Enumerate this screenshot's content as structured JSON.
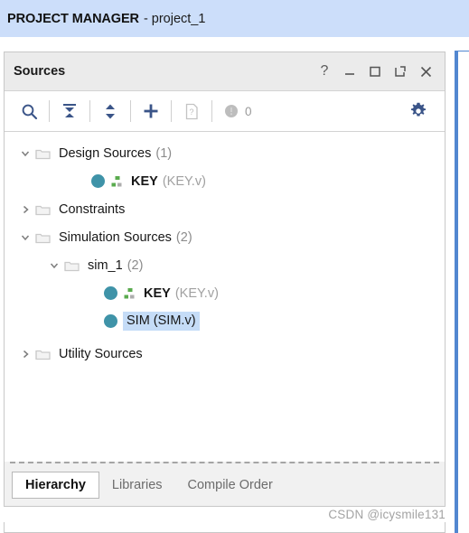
{
  "header": {
    "title": "PROJECT MANAGER",
    "separator": "-",
    "project_name": "project_1"
  },
  "panel": {
    "title": "Sources",
    "titlebar_buttons": [
      {
        "name": "help-icon",
        "label": "?"
      },
      {
        "name": "minimize-icon",
        "label": "_"
      },
      {
        "name": "maximize-icon",
        "label": "□"
      },
      {
        "name": "float-icon",
        "label": "↗"
      },
      {
        "name": "close-icon",
        "label": "×"
      }
    ],
    "toolbar": {
      "search_tooltip": "Search",
      "collapse_tooltip": "Collapse All",
      "expand_tooltip": "Expand All",
      "add_tooltip": "Add Sources",
      "report_tooltip": "Report",
      "warning_count": "0",
      "settings_tooltip": "Settings"
    },
    "colors": {
      "header_bg": "#ccdefa",
      "accent_blue": "#5287d0",
      "toolbar_icon": "#3a5488",
      "module_dot": "#3f93a8",
      "module_green": "#5aab4e",
      "selection": "#c5dcf7"
    }
  },
  "tree": [
    {
      "id": "design-sources",
      "indent": 0,
      "type": "folder",
      "twisty": "expanded",
      "label": "Design Sources",
      "count": "(1)"
    },
    {
      "id": "design-sources-key",
      "indent": 1,
      "type": "module",
      "twisty": "none",
      "label": "KEY",
      "ext": "(KEY.v)",
      "has_module_icon": true,
      "selected": false
    },
    {
      "id": "constraints",
      "indent": 0,
      "type": "folder",
      "twisty": "collapsed",
      "label": "Constraints",
      "count": ""
    },
    {
      "id": "simulation-sources",
      "indent": 0,
      "type": "folder",
      "twisty": "expanded",
      "label": "Simulation Sources",
      "count": "(2)"
    },
    {
      "id": "sim-1",
      "indent": 1,
      "type": "folder",
      "twisty": "expanded",
      "label": "sim_1",
      "count": "(2)"
    },
    {
      "id": "sim-1-key",
      "indent": 2,
      "type": "module",
      "twisty": "none",
      "label": "KEY",
      "ext": "(KEY.v)",
      "has_module_icon": true,
      "selected": false
    },
    {
      "id": "sim-1-sim",
      "indent": 2,
      "type": "module",
      "twisty": "none",
      "label": "SIM (SIM.v)",
      "ext": "",
      "has_module_icon": false,
      "selected": true
    },
    {
      "id": "utility-sources",
      "indent": 0,
      "type": "folder",
      "twisty": "collapsed",
      "label": "Utility Sources",
      "count": ""
    }
  ],
  "tabs": [
    {
      "id": "hierarchy",
      "label": "Hierarchy",
      "active": true
    },
    {
      "id": "libraries",
      "label": "Libraries",
      "active": false
    },
    {
      "id": "compile-order",
      "label": "Compile Order",
      "active": false
    }
  ],
  "watermark": "CSDN @icysmile131"
}
